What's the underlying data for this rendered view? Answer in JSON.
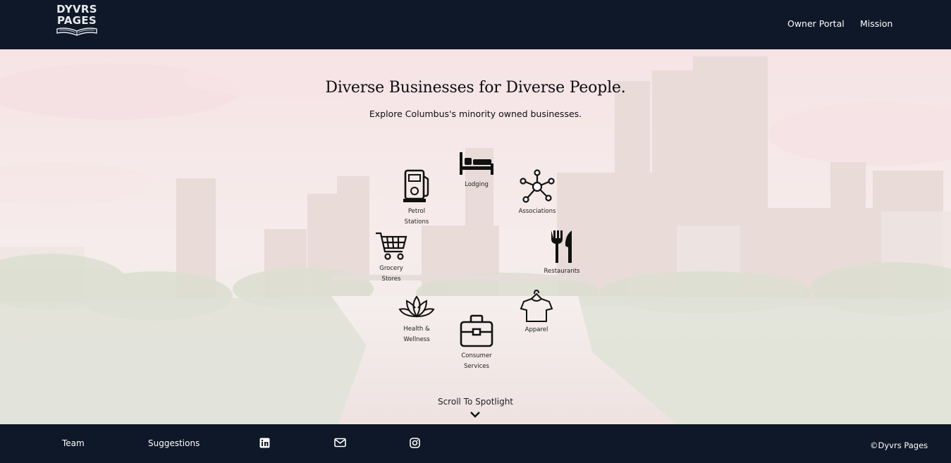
{
  "brand": {
    "line1": "DYVRS",
    "line2": "PAGES"
  },
  "nav": {
    "owner_portal": "Owner Portal",
    "mission": "Mission"
  },
  "hero": {
    "headline": "Diverse Businesses for Diverse People.",
    "subline": "Explore Columbus's minority owned businesses.",
    "scroll_label": "Scroll To Spotlight"
  },
  "categories": [
    {
      "label": "Lodging",
      "icon": "bed-icon"
    },
    {
      "label": "Petrol\nStations",
      "icon": "fuel-pump-icon"
    },
    {
      "label": "Associations",
      "icon": "network-icon"
    },
    {
      "label": "Grocery\nStores",
      "icon": "shopping-cart-icon"
    },
    {
      "label": "Restaurants",
      "icon": "fork-knife-icon"
    },
    {
      "label": "Health &\nWellness",
      "icon": "lotus-icon"
    },
    {
      "label": "Apparel",
      "icon": "shirt-icon"
    },
    {
      "label": "Consumer\nServices",
      "icon": "toolbox-icon"
    }
  ],
  "footer": {
    "team": "Team",
    "suggestions": "Suggestions",
    "copyright": "©Dyvrs Pages",
    "icons": [
      "linkedin-icon",
      "mail-icon",
      "instagram-icon"
    ]
  },
  "colors": {
    "bar": "#0e1828",
    "text_dark": "#0c0c10"
  }
}
